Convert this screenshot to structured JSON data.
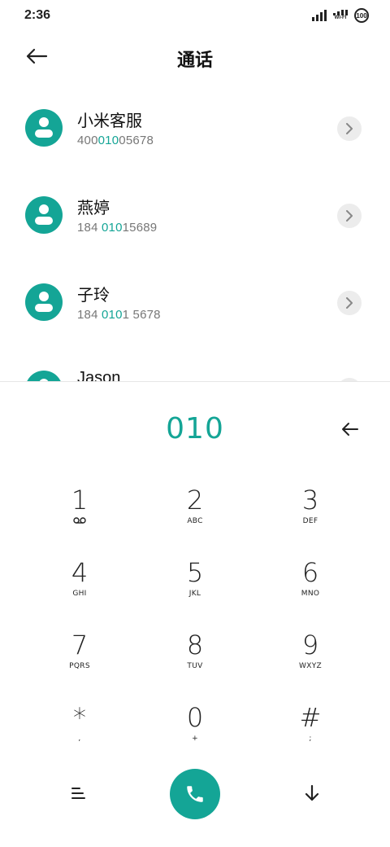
{
  "status_bar": {
    "time": "2:36",
    "wifi_label": "WI-FI",
    "battery": "100"
  },
  "header": {
    "title": "通话"
  },
  "contacts": [
    {
      "name": "小米客服",
      "number_parts": [
        "400",
        "010",
        "05678"
      ]
    },
    {
      "name": "燕婷",
      "number_parts": [
        "184 ",
        "010",
        "15689"
      ]
    },
    {
      "name": "子玲",
      "number_parts": [
        "184 ",
        "010",
        "1 5678"
      ]
    },
    {
      "name": "Jason"
    }
  ],
  "dialer": {
    "input": "010",
    "keys": [
      {
        "digit": "1",
        "sub": "voicemail-icon"
      },
      {
        "digit": "2",
        "sub": "ABC"
      },
      {
        "digit": "3",
        "sub": "DEF"
      },
      {
        "digit": "4",
        "sub": "GHI"
      },
      {
        "digit": "5",
        "sub": "JKL"
      },
      {
        "digit": "6",
        "sub": "MNO"
      },
      {
        "digit": "7",
        "sub": "PQRS"
      },
      {
        "digit": "8",
        "sub": "TUV"
      },
      {
        "digit": "9",
        "sub": "WXYZ"
      },
      {
        "digit": "*",
        "sub": ","
      },
      {
        "digit": "0",
        "sub": "+"
      },
      {
        "digit": "#",
        "sub": ";"
      }
    ]
  },
  "icons": {
    "back": "arrow-left-icon",
    "detail": "chevron-right-icon",
    "delete": "backspace-arrow-icon",
    "menu": "menu-lines-icon",
    "call": "phone-icon",
    "collapse": "arrow-down-icon"
  },
  "colors": {
    "accent": "#14a596",
    "text": "#111111",
    "muted": "#777777"
  }
}
